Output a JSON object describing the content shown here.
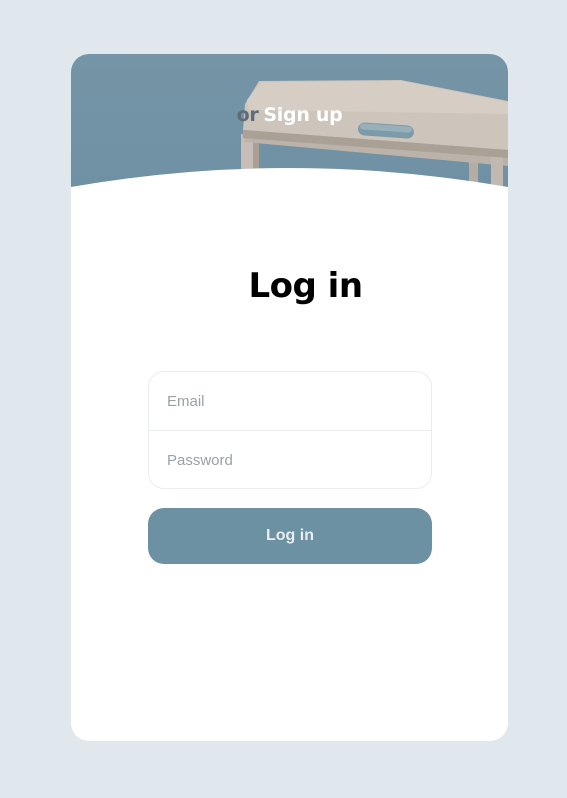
{
  "header": {
    "or_text": "or",
    "signup_link": "Sign up"
  },
  "main": {
    "title": "Log in",
    "email": {
      "placeholder": "Email",
      "value": ""
    },
    "password": {
      "placeholder": "Password",
      "value": ""
    },
    "submit_label": "Log in"
  },
  "colors": {
    "page_background": "#e0e7ed",
    "hero_blue": "#6d8fa2",
    "button": "#6b91a3"
  }
}
